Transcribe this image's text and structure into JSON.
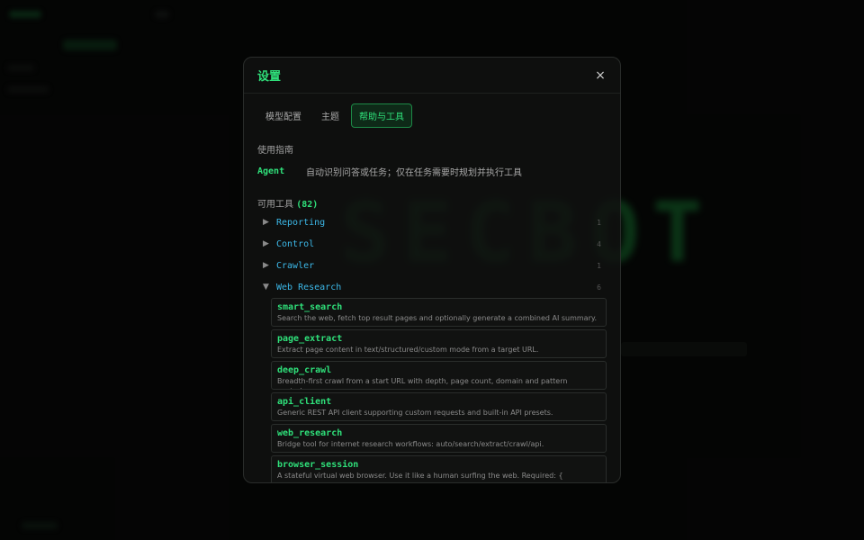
{
  "background": {
    "logo_text": "SECBOT"
  },
  "modal": {
    "title": "设置",
    "close_label": "×",
    "tabs": [
      {
        "label": "模型配置",
        "active": false
      },
      {
        "label": "主题",
        "active": false
      },
      {
        "label": "帮助与工具",
        "active": true
      }
    ],
    "guide": {
      "label": "使用指南",
      "agent_tag": "Agent",
      "agent_desc": "自动识别问答或任务；仅在任务需要时规划并执行工具"
    },
    "tools": {
      "label": "可用工具",
      "count": "(82)",
      "categories": [
        {
          "name": "Reporting",
          "count": "1",
          "expanded": false
        },
        {
          "name": "Control",
          "count": "4",
          "expanded": false
        },
        {
          "name": "Crawler",
          "count": "1",
          "expanded": false
        },
        {
          "name": "Web Research",
          "count": "6",
          "expanded": true
        }
      ],
      "items": [
        {
          "name": "smart_search",
          "desc": "Search the web, fetch top result pages and optionally generate a combined AI summary."
        },
        {
          "name": "page_extract",
          "desc": "Extract page content in text/structured/custom mode from a target URL."
        },
        {
          "name": "deep_crawl",
          "desc": "Breadth-first crawl from a start URL with depth, page count, domain and pattern controls."
        },
        {
          "name": "api_client",
          "desc": "Generic REST API client supporting custom requests and built-in API presets."
        },
        {
          "name": "web_research",
          "desc": "Bridge tool for internet research workflows: auto/search/extract/crawl/api."
        },
        {
          "name": "browser_session",
          "desc": "A stateful virtual web browser. Use it like a human surfing the web. Required: { session_id: string, action: \"open\"|\"search\"|\"follow\"|\"back\"|\"read\"|\"note\"|\"status\"|\"close\", ... } Typical"
        }
      ]
    }
  },
  "icons": {
    "collapsed": "triangle-right-icon",
    "expanded": "triangle-down-icon"
  },
  "colors": {
    "accent": "#2fe07a",
    "category": "#3cb8e8"
  }
}
